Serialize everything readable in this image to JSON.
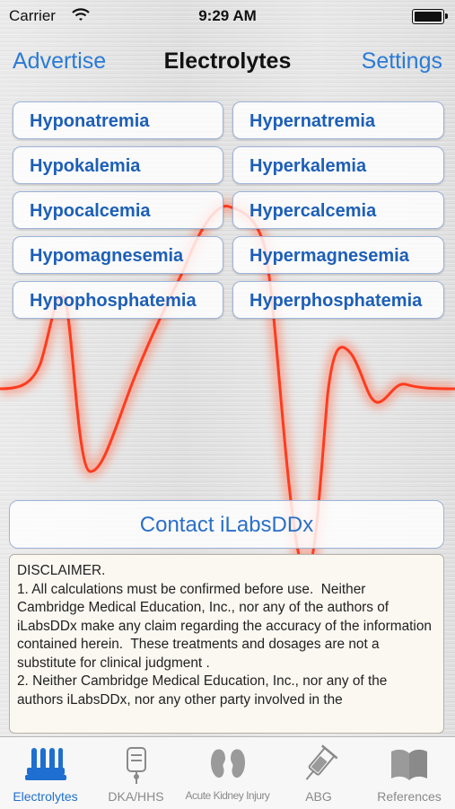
{
  "status_bar": {
    "carrier": "Carrier",
    "time": "9:29 AM"
  },
  "nav": {
    "left": "Advertise",
    "title": "Electrolytes",
    "right": "Settings"
  },
  "conditions": {
    "left": [
      "Hyponatremia",
      "Hypokalemia",
      "Hypocalcemia",
      "Hypomagnesemia",
      "Hypophosphatemia"
    ],
    "right": [
      "Hypernatremia",
      "Hyperkalemia",
      "Hypercalcemia",
      "Hypermagnesemia",
      "Hyperphosphatemia"
    ]
  },
  "contact_button": "Contact iLabsDDx",
  "disclaimer": "DISCLAIMER.\n1. All calculations must be confirmed before use.  Neither Cambridge Medical Education, Inc., nor any of the authors of iLabsDDx make any claim regarding the accuracy of the information contained herein.  These treatments and dosages are not a substitute for clinical judgment .\n2. Neither Cambridge Medical Education, Inc., nor any of the authors iLabsDDx, nor any other party involved in the",
  "tabs": [
    {
      "label": "Electrolytes",
      "icon": "test-tubes-icon",
      "active": true
    },
    {
      "label": "DKA/HHS",
      "icon": "iv-bag-icon",
      "active": false
    },
    {
      "label": "Acute Kidney Injury",
      "icon": "kidney-icon",
      "active": false
    },
    {
      "label": "ABG",
      "icon": "syringe-icon",
      "active": false
    },
    {
      "label": "References",
      "icon": "book-icon",
      "active": false
    }
  ],
  "colors": {
    "accent": "#2a7ad6",
    "ecg": "#ff3b1f",
    "active_tab": "#1e6fd0"
  }
}
